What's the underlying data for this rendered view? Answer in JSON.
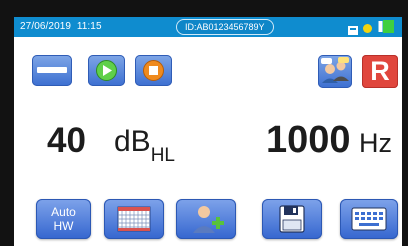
{
  "status_bar": {
    "date": "27/06/2019",
    "time": "11:15",
    "device_id": "ID:AB0123456789Y",
    "icons": [
      "storage-icon",
      "connection-icon",
      "battery-icon"
    ]
  },
  "toolbar": {
    "stop_icon": "minus-icon",
    "play_icon": "play-icon",
    "record_icon": "stop-icon",
    "patient_icon": "patient-talk-icon",
    "side_label": "R"
  },
  "readouts": {
    "level_value": "40",
    "level_unit": "dB",
    "level_unit_sub": "HL",
    "frequency_value": "1000",
    "frequency_unit": "Hz"
  },
  "bottom_buttons": {
    "auto_line1": "Auto",
    "auto_line2": "HW",
    "audiogram_icon": "audiogram-grid-icon",
    "add_patient_icon": "add-patient-icon",
    "save_icon": "floppy-disk-icon",
    "keyboard_icon": "keyboard-icon"
  },
  "colors": {
    "status_bar": "#0f8ccf",
    "button_blue": "#3c6fd1",
    "play_green": "#5fd04a",
    "record_orange": "#ef8a1e",
    "side_red": "#e0463d"
  }
}
